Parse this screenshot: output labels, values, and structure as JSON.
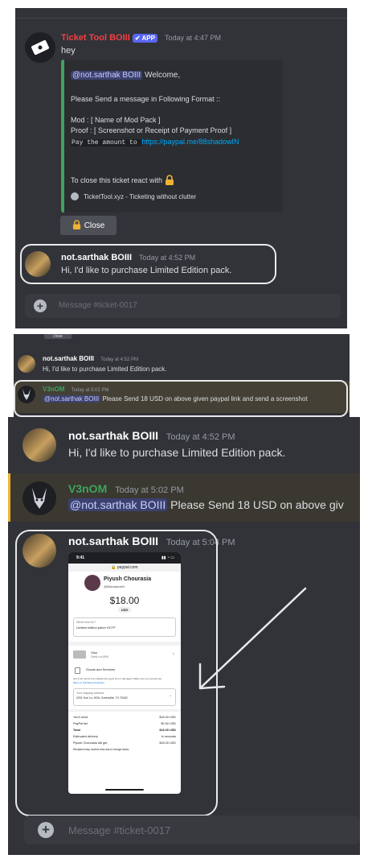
{
  "panel1": {
    "bot_name": "Ticket Tool BOIII",
    "app_badge": "✔ APP",
    "bot_time": "Today at 4:47 PM",
    "bot_msg": "hey",
    "embed": {
      "mention": "@not.sarthak BOIII",
      "welcome": " Welcome,",
      "instruction": "Please Send a message in Following Format ::",
      "mod_line": "Mod : [ Name of Mod Pack ]",
      "proof_line": "Proof : [ Screenshot or Receipt of Payment Proof ]",
      "pay_text": "Pay the amount to ",
      "pay_link": "https://paypal.me/88shadowIN",
      "close_text": "To close this ticket react with",
      "footer": "TicketTool.xyz - Ticketing without clutter",
      "accent": "#3ba55c"
    },
    "close_button": "Close",
    "user_name": "not.sarthak BOIII",
    "user_time": "Today at 4:52 PM",
    "user_msg": "Hi, I'd like to purchase Limited Edition pack.",
    "input_placeholder": "Message #ticket-0017"
  },
  "panel2": {
    "top_fragment": "close",
    "user_name": "not.sarthak BOIII",
    "user_time": "Today at 4:52 PM",
    "user_msg": "Hi, I'd like to purchase Limited Edition pack.",
    "v_name": "V3nOM",
    "v_time": "Today at 5:02 PM",
    "v_mention": "@not.sarthak BOIII",
    "v_msg": " Please Send 18 USD on above given paypal link and send a screenshot"
  },
  "panel3": {
    "user_name": "not.sarthak BOIII",
    "user_time": "Today at 4:52 PM",
    "user_msg": "Hi, I'd like to purchase Limited Edition pack.",
    "v_name": "V3nOM",
    "v_time": "Today at 5:02 PM",
    "v_mention": "@not.sarthak BOIII",
    "v_msg": " Please Send 18 USD on above giv",
    "u2_name": "not.sarthak BOIII",
    "u2_time": "Today at 5:04 PM",
    "input_placeholder": "Message #ticket-0017",
    "phone": {
      "status_time": "9:41",
      "url": "🔒 paypal.com",
      "payee": "Piyush Chourasia",
      "handle": "@88shadowIN",
      "amount": "$18.00",
      "currency": "USD",
      "for_label": "What's this for?",
      "for_value": "Limited edition patch HCTP",
      "card_label": "Visa",
      "card_sub": "Debit ••••1695",
      "goods": "Goods and Services",
      "protection": "Get a full refund if an eligible item gets lost or damaged. Make sure you accept tips.",
      "protection_link": "More on Purchase Protection",
      "ship_label": "Your shipping address",
      "ship_value": "2201 Kuri Ln, HSA, Greenville, TX 75402",
      "rows": [
        {
          "label": "You'll send",
          "value": "$18.00 USD"
        },
        {
          "label": "PayPal fee",
          "value": "$0.00 USD"
        },
        {
          "label": "Total",
          "value": "$18.00 USD"
        },
        {
          "label": "Estimated delivery",
          "value": "In seconds"
        },
        {
          "label": "Piyush Chourasia will get",
          "value": "$18.00 USD"
        }
      ],
      "foot": "Recipient may receive less due to foreign taxes."
    }
  }
}
